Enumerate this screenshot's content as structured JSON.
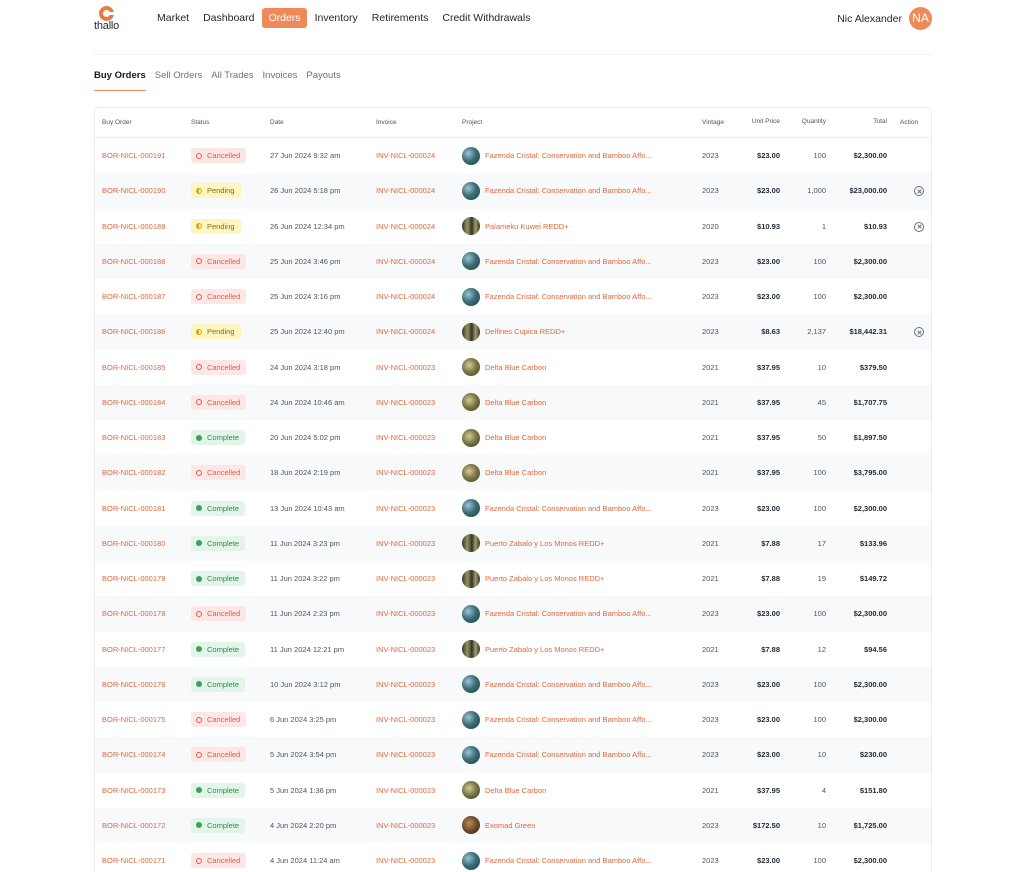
{
  "brand": {
    "name": "thallo"
  },
  "nav": [
    {
      "label": "Market",
      "active": false
    },
    {
      "label": "Dashboard",
      "active": false
    },
    {
      "label": "Orders",
      "active": true
    },
    {
      "label": "Inventory",
      "active": false
    },
    {
      "label": "Retirements",
      "active": false
    },
    {
      "label": "Credit Withdrawals",
      "active": false
    }
  ],
  "user": {
    "name": "Nic Alexander",
    "initials": "NA"
  },
  "subtabs": [
    {
      "label": "Buy Orders",
      "active": true
    },
    {
      "label": "Sell Orders",
      "active": false
    },
    {
      "label": "All Trades",
      "active": false
    },
    {
      "label": "Invoices",
      "active": false
    },
    {
      "label": "Payouts",
      "active": false
    }
  ],
  "columns": {
    "buy_order": "Buy Order",
    "status": "Status",
    "date": "Date",
    "invoice": "Invoice",
    "project": "Project",
    "vintage": "Vintage",
    "unit_price": "Unit Price",
    "quantity": "Quantity",
    "total": "Total",
    "action": "Action"
  },
  "colors": {
    "accent": "#ee8a59",
    "link": "#e0683a",
    "cancelled": "#e05c4c",
    "pending": "#d9a517",
    "complete": "#3aa160"
  },
  "rows": [
    {
      "order": "BOR-NICL-000191",
      "status": "Cancelled",
      "date": "27 Jun 2024 9:32 am",
      "invoice": "INV-NICL-000024",
      "project": "Fazenda Cristal: Conservation and Bamboo Affo...",
      "thumb": "forest",
      "vintage": "2023",
      "unit_price": "$23.00",
      "quantity": "100",
      "total": "$2,300.00",
      "action": false
    },
    {
      "order": "BOR-NICL-000190",
      "status": "Pending",
      "date": "26 Jun 2024 5:18 pm",
      "invoice": "INV-NICL-000024",
      "project": "Fazenda Cristal: Conservation and Bamboo Affo...",
      "thumb": "forest",
      "vintage": "2023",
      "unit_price": "$23.00",
      "quantity": "1,000",
      "total": "$23,000.00",
      "action": true
    },
    {
      "order": "BOR-NICL-000189",
      "status": "Pending",
      "date": "26 Jun 2024 12:34 pm",
      "invoice": "INV-NICL-000024",
      "project": "Palameku Kuwei REDD+",
      "thumb": "trees",
      "vintage": "2020",
      "unit_price": "$10.93",
      "quantity": "1",
      "total": "$10.93",
      "action": true
    },
    {
      "order": "BOR-NICL-000188",
      "status": "Cancelled",
      "date": "25 Jun 2024 3:46 pm",
      "invoice": "INV-NICL-000024",
      "project": "Fazenda Cristal: Conservation and Bamboo Affo...",
      "thumb": "forest",
      "vintage": "2023",
      "unit_price": "$23.00",
      "quantity": "100",
      "total": "$2,300.00",
      "action": false
    },
    {
      "order": "BOR-NICL-000187",
      "status": "Cancelled",
      "date": "25 Jun 2024 3:16 pm",
      "invoice": "INV-NICL-000024",
      "project": "Fazenda Cristal: Conservation and Bamboo Affo...",
      "thumb": "forest",
      "vintage": "2023",
      "unit_price": "$23.00",
      "quantity": "100",
      "total": "$2,300.00",
      "action": false
    },
    {
      "order": "BOR-NICL-000186",
      "status": "Pending",
      "date": "25 Jun 2024 12:40 pm",
      "invoice": "INV-NICL-000024",
      "project": "Delfines Cupica REDD+",
      "thumb": "trees",
      "vintage": "2023",
      "unit_price": "$8.63",
      "quantity": "2,137",
      "total": "$18,442.31",
      "action": true
    },
    {
      "order": "BOR-NICL-000185",
      "status": "Cancelled",
      "date": "24 Jun 2024 3:18 pm",
      "invoice": "INV-NICL-000023",
      "project": "Delta Blue Carbon",
      "thumb": "earth",
      "vintage": "2021",
      "unit_price": "$37.95",
      "quantity": "10",
      "total": "$379.50",
      "action": false
    },
    {
      "order": "BOR-NICL-000184",
      "status": "Cancelled",
      "date": "24 Jun 2024 10:46 am",
      "invoice": "INV-NICL-000023",
      "project": "Delta Blue Carbon",
      "thumb": "earth",
      "vintage": "2021",
      "unit_price": "$37.95",
      "quantity": "45",
      "total": "$1,707.75",
      "action": false
    },
    {
      "order": "BOR-NICL-000183",
      "status": "Complete",
      "date": "20 Jun 2024 5:02 pm",
      "invoice": "INV-NICL-000023",
      "project": "Delta Blue Carbon",
      "thumb": "earth",
      "vintage": "2021",
      "unit_price": "$37.95",
      "quantity": "50",
      "total": "$1,897.50",
      "action": false
    },
    {
      "order": "BOR-NICL-000182",
      "status": "Cancelled",
      "date": "18 Jun 2024 2:19 pm",
      "invoice": "INV-NICL-000023",
      "project": "Delta Blue Carbon",
      "thumb": "earth",
      "vintage": "2021",
      "unit_price": "$37.95",
      "quantity": "100",
      "total": "$3,795.00",
      "action": false
    },
    {
      "order": "BOR-NICL-000181",
      "status": "Complete",
      "date": "13 Jun 2024 10:43 am",
      "invoice": "INV-NICL-000023",
      "project": "Fazenda Cristal: Conservation and Bamboo Affo...",
      "thumb": "forest",
      "vintage": "2023",
      "unit_price": "$23.00",
      "quantity": "100",
      "total": "$2,300.00",
      "action": false
    },
    {
      "order": "BOR-NICL-000180",
      "status": "Complete",
      "date": "11 Jun 2024 3:23 pm",
      "invoice": "INV-NICL-000023",
      "project": "Puerto Zabalo y Los Monos REDD+",
      "thumb": "trees",
      "vintage": "2021",
      "unit_price": "$7.88",
      "quantity": "17",
      "total": "$133.96",
      "action": false
    },
    {
      "order": "BOR-NICL-000179",
      "status": "Complete",
      "date": "11 Jun 2024 3:22 pm",
      "invoice": "INV-NICL-000023",
      "project": "Puerto Zabalo y Los Monos REDD+",
      "thumb": "trees",
      "vintage": "2021",
      "unit_price": "$7.88",
      "quantity": "19",
      "total": "$149.72",
      "action": false
    },
    {
      "order": "BOR-NICL-000178",
      "status": "Cancelled",
      "date": "11 Jun 2024 2:23 pm",
      "invoice": "INV-NICL-000023",
      "project": "Fazenda Cristal: Conservation and Bamboo Affo...",
      "thumb": "forest",
      "vintage": "2023",
      "unit_price": "$23.00",
      "quantity": "100",
      "total": "$2,300.00",
      "action": false
    },
    {
      "order": "BOR-NICL-000177",
      "status": "Complete",
      "date": "11 Jun 2024 12:21 pm",
      "invoice": "INV-NICL-000023",
      "project": "Puerto Zabalo y Los Monos REDD+",
      "thumb": "trees",
      "vintage": "2021",
      "unit_price": "$7.88",
      "quantity": "12",
      "total": "$94.56",
      "action": false
    },
    {
      "order": "BOR-NICL-000176",
      "status": "Complete",
      "date": "10 Jun 2024 3:12 pm",
      "invoice": "INV-NICL-000023",
      "project": "Fazenda Cristal: Conservation and Bamboo Affo...",
      "thumb": "forest",
      "vintage": "2023",
      "unit_price": "$23.00",
      "quantity": "100",
      "total": "$2,300.00",
      "action": false
    },
    {
      "order": "BOR-NICL-000175",
      "status": "Cancelled",
      "date": "6 Jun 2024 3:25 pm",
      "invoice": "INV-NICL-000023",
      "project": "Fazenda Cristal: Conservation and Bamboo Affo...",
      "thumb": "forest",
      "vintage": "2023",
      "unit_price": "$23.00",
      "quantity": "100",
      "total": "$2,300.00",
      "action": false
    },
    {
      "order": "BOR-NICL-000174",
      "status": "Cancelled",
      "date": "5 Jun 2024 3:54 pm",
      "invoice": "INV-NICL-000023",
      "project": "Fazenda Cristal: Conservation and Bamboo Affo...",
      "thumb": "forest",
      "vintage": "2023",
      "unit_price": "$23.00",
      "quantity": "10",
      "total": "$230.00",
      "action": false
    },
    {
      "order": "BOR-NICL-000173",
      "status": "Complete",
      "date": "5 Jun 2024 1:36 pm",
      "invoice": "INV-NICL-000023",
      "project": "Delta Blue Carbon",
      "thumb": "earth",
      "vintage": "2021",
      "unit_price": "$37.95",
      "quantity": "4",
      "total": "$151.80",
      "action": false
    },
    {
      "order": "BOR-NICL-000172",
      "status": "Complete",
      "date": "4 Jun 2024 2:20 pm",
      "invoice": "INV-NICL-000023",
      "project": "Exomad Green",
      "thumb": "bark",
      "vintage": "2023",
      "unit_price": "$172.50",
      "quantity": "10",
      "total": "$1,725.00",
      "action": false
    },
    {
      "order": "BOR-NICL-000171",
      "status": "Cancelled",
      "date": "4 Jun 2024 11:24 am",
      "invoice": "INV-NICL-000023",
      "project": "Fazenda Cristal: Conservation and Bamboo Affo...",
      "thumb": "forest",
      "vintage": "2023",
      "unit_price": "$23.00",
      "quantity": "100",
      "total": "$2,300.00",
      "action": false
    }
  ]
}
